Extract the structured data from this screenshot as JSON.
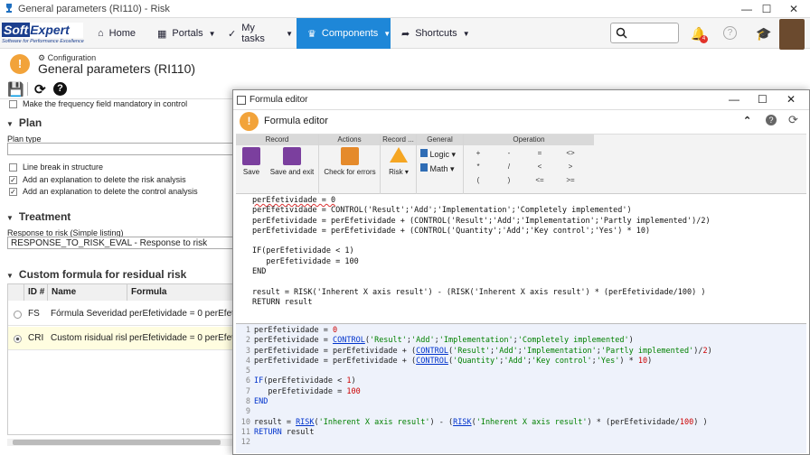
{
  "window": {
    "title": "General parameters (RI110) - Risk"
  },
  "nav": {
    "logo_text_a": "Soft",
    "logo_text_b": "Expert",
    "logo_sub": "Software for Performance Excellence",
    "items": [
      {
        "label": "Home"
      },
      {
        "label": "Portals"
      },
      {
        "label": "My tasks"
      },
      {
        "label": "Components"
      },
      {
        "label": "Shortcuts"
      }
    ],
    "notifications_count": "4"
  },
  "page": {
    "subtitle": "Configuration",
    "title": "General parameters (RI110)"
  },
  "left": {
    "frequency_text": "Make the frequency field mandatory in control",
    "plan_section": "Plan",
    "plan_type_label": "Plan type",
    "chk_linebreak": "Line break in structure",
    "chk_delete_risk": "Add an explanation to delete the risk analysis",
    "chk_delete_control": "Add an explanation to delete the control analysis",
    "treatment_section": "Treatment",
    "response_label": "Response to risk (Simple listing)",
    "response_value": "RESPONSE_TO_RISK_EVAL - Response to risk",
    "custom_section": "Custom formula for residual risk",
    "grid": {
      "headers": [
        "ID #",
        "Name",
        "Formula"
      ],
      "rows": [
        {
          "id": "FS",
          "name": "Fórmula Severidade",
          "formula": "perEfetividade = 0 perEfetivi"
        },
        {
          "id": "CRI",
          "name": "Custom risidual risk",
          "formula": "perEfetividade = 0 perEfetivi"
        }
      ]
    }
  },
  "modal": {
    "window_title": "Formula editor",
    "header": "Formula editor",
    "groups": {
      "record": "Record",
      "actions": "Actions",
      "record2": "Record ...",
      "general": "General",
      "operation": "Operation"
    },
    "buttons": {
      "save": "Save",
      "save_exit": "Save and exit",
      "check": "Check for errors",
      "risk": "Risk",
      "logic": "Logic",
      "math": "Math"
    },
    "ops": [
      "+",
      "-",
      "=",
      "<>",
      "*",
      "/",
      "<",
      ">",
      "(",
      ")",
      "<=",
      ">="
    ],
    "code_preview": [
      "perEfetividade = 0",
      "perEfetividade = CONTROL('Result';'Add';'Implementation';'Completely implemented')",
      "perEfetividade = perEfetividade + (CONTROL('Result';'Add';'Implementation';'Partly implemented')/2)",
      "perEfetividade = perEfetividade + (CONTROL('Quantity';'Add';'Key control';'Yes') * 10)",
      "",
      "IF(perEfetividade < 1)",
      "   perEfetividade = 100",
      "END",
      "",
      "result = RISK('Inherent X axis result') - (RISK('Inherent X axis result') * (perEfetividade/100) )",
      "RETURN result"
    ],
    "line_numbers": [
      "1",
      "2",
      "3",
      "4",
      "5",
      "6",
      "7",
      "8",
      "9",
      "10",
      "11",
      "12"
    ]
  },
  "colors": {
    "accent": "#1e87d8",
    "warning": "#f2a33a",
    "editor_bg": "#eef2fb"
  }
}
